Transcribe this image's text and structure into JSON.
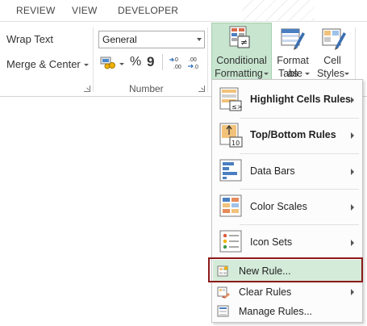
{
  "tabs": [
    "REVIEW",
    "VIEW",
    "DEVELOPER"
  ],
  "alignment": {
    "wrap_text": "Wrap Text",
    "merge_center": "Merge & Center"
  },
  "number": {
    "format_value": "General",
    "group_label": "Number",
    "percent": "%",
    "comma": "9",
    "increase_decimal": ".0\n.00",
    "decrease_decimal": ".00\n→.0"
  },
  "styles": {
    "conditional_formatting": [
      "Conditional",
      "Formatting"
    ],
    "format_as_table": [
      "Format as",
      "Table"
    ],
    "cell_styles": [
      "Cell",
      "Styles"
    ]
  },
  "menu": {
    "items": [
      {
        "label": "Highlight Cells Rules",
        "icon": "highlight-cells-icon",
        "submenu": true
      },
      {
        "label": "Top/Bottom Rules",
        "icon": "top-bottom-icon",
        "submenu": true
      },
      {
        "label": "Data Bars",
        "icon": "data-bars-icon",
        "submenu": true
      },
      {
        "label": "Color Scales",
        "icon": "color-scales-icon",
        "submenu": true
      },
      {
        "label": "Icon Sets",
        "icon": "icon-sets-icon",
        "submenu": true
      },
      {
        "label": "New Rule...",
        "icon": "new-rule-icon",
        "submenu": false
      },
      {
        "label": "Clear Rules",
        "icon": "clear-rules-icon",
        "submenu": true
      },
      {
        "label": "Manage Rules...",
        "icon": "manage-rules-icon",
        "submenu": false
      }
    ]
  },
  "colors": {
    "selected_button_bg": "#c7e5cf",
    "hover_bg": "#d4ebd9",
    "highlight_border": "#8b1a1a"
  }
}
